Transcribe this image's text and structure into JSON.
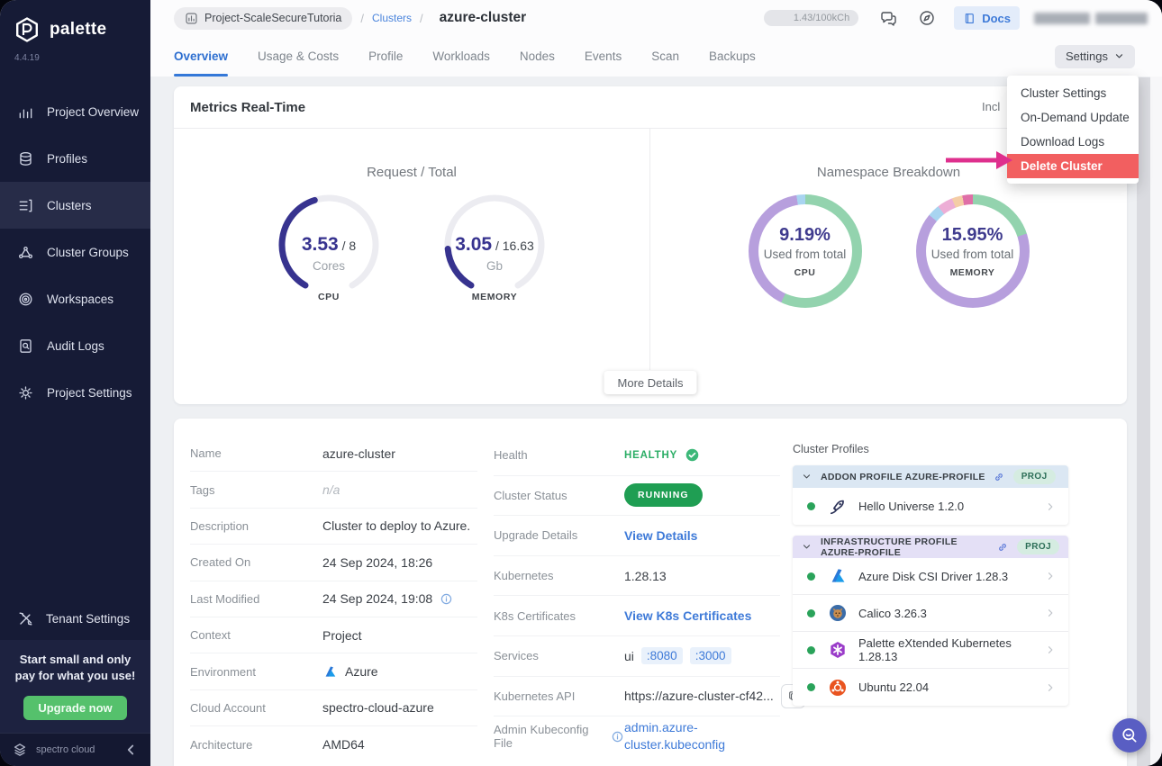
{
  "app": {
    "name": "palette",
    "version": "4.4.19"
  },
  "sidebar": {
    "items": [
      {
        "label": "Project Overview",
        "icon": "overview",
        "active": false
      },
      {
        "label": "Profiles",
        "icon": "profiles",
        "active": false
      },
      {
        "label": "Clusters",
        "icon": "clusters",
        "active": true
      },
      {
        "label": "Cluster Groups",
        "icon": "cluster-groups",
        "active": false
      },
      {
        "label": "Workspaces",
        "icon": "workspaces",
        "active": false
      },
      {
        "label": "Audit Logs",
        "icon": "audit",
        "active": false
      },
      {
        "label": "Project Settings",
        "icon": "gear",
        "active": false
      }
    ],
    "tenant_settings_label": "Tenant Settings",
    "upgrade": {
      "message": "Start small and only pay for what you use!",
      "button_label": "Upgrade now"
    },
    "footer_brand": "spectro cloud"
  },
  "header": {
    "breadcrumb": {
      "project": "Project-ScaleSecureTutoria",
      "section": "Clusters",
      "current": "azure-cluster"
    },
    "usage_badge": "1.43/100kCh",
    "docs_label": "Docs"
  },
  "tabs": {
    "items": [
      "Overview",
      "Usage & Costs",
      "Profile",
      "Workloads",
      "Nodes",
      "Events",
      "Scan",
      "Backups"
    ],
    "active": "Overview",
    "settings_button_label": "Settings"
  },
  "settings_menu": {
    "items": [
      "Cluster Settings",
      "On-Demand Update",
      "Download Logs",
      "Delete Cluster"
    ],
    "highlighted": "Delete Cluster"
  },
  "metrics": {
    "title": "Metrics Real-Time",
    "clipped_right_text": "Incl",
    "left_title": "Request / Total",
    "right_title": "Namespace Breakdown",
    "more_details_label": "More Details"
  },
  "chart_data": [
    {
      "type": "gauge",
      "group": "Request / Total",
      "label": "CPU",
      "value": "3.53",
      "total": "8",
      "unit": "Cores",
      "color": "#37338f",
      "track": "#ececf1"
    },
    {
      "type": "gauge",
      "group": "Request / Total",
      "label": "MEMORY",
      "value": "3.05",
      "total": "16.63",
      "unit": "Gb",
      "color": "#37338f",
      "track": "#ececf1"
    },
    {
      "type": "donut",
      "group": "Namespace Breakdown",
      "label": "CPU",
      "center_value": "9.19%",
      "center_caption": "Used from total",
      "segments": [
        {
          "color": "#93d3ae",
          "pct": 57
        },
        {
          "color": "#b79fdd",
          "pct": 40.5
        },
        {
          "color": "#a8d4f0",
          "pct": 2.5
        }
      ]
    },
    {
      "type": "donut",
      "group": "Namespace Breakdown",
      "label": "MEMORY",
      "center_value": "15.95%",
      "center_caption": "Used from total",
      "segments": [
        {
          "color": "#93d3ae",
          "pct": 20
        },
        {
          "color": "#b79fdd",
          "pct": 66
        },
        {
          "color": "#a8d4f0",
          "pct": 3.5
        },
        {
          "color": "#edaed6",
          "pct": 4.5
        },
        {
          "color": "#f4cda6",
          "pct": 3
        },
        {
          "color": "#df6fa7",
          "pct": 3
        }
      ]
    }
  ],
  "cluster_info": {
    "rows": [
      {
        "label": "Name",
        "value": "azure-cluster"
      },
      {
        "label": "Tags",
        "value": "n/a",
        "muted": true
      },
      {
        "label": "Description",
        "value": "Cluster to deploy to Azure."
      },
      {
        "label": "Created On",
        "value": "24 Sep 2024, 18:26"
      },
      {
        "label": "Last Modified",
        "value": "24 Sep 2024, 19:08",
        "info": true
      },
      {
        "label": "Context",
        "value": "Project"
      },
      {
        "label": "Environment",
        "value": "Azure",
        "icon": "azure"
      },
      {
        "label": "Cloud Account",
        "value": "spectro-cloud-azure"
      },
      {
        "label": "Architecture",
        "value": "AMD64"
      }
    ]
  },
  "cluster_status": {
    "rows": [
      {
        "label": "Health",
        "kind": "health",
        "value": "HEALTHY"
      },
      {
        "label": "Cluster Status",
        "kind": "badge",
        "value": "RUNNING"
      },
      {
        "label": "Upgrade Details",
        "kind": "link",
        "value": "View Details"
      },
      {
        "label": "Kubernetes",
        "kind": "text",
        "value": "1.28.13"
      },
      {
        "label": "K8s Certificates",
        "kind": "link",
        "value": "View K8s Certificates"
      },
      {
        "label": "Services",
        "kind": "services",
        "value": "ui",
        "ports": [
          ":8080",
          ":3000"
        ]
      },
      {
        "label": "Kubernetes API",
        "kind": "api",
        "value": "https://azure-cluster-cf42..."
      },
      {
        "label": "Admin Kubeconfig File",
        "kind": "filelink",
        "info": true,
        "value": "admin.azure-cluster.kubeconfig"
      }
    ]
  },
  "cluster_profiles": {
    "title": "Cluster Profiles",
    "groups": [
      {
        "header": "ADDON PROFILE AZURE-PROFILE",
        "badge": "PROJ",
        "theme": "blue",
        "items": [
          {
            "name": "Hello Universe 1.2.0",
            "icon": "rocket"
          }
        ]
      },
      {
        "header": "INFRASTRUCTURE PROFILE AZURE-PROFILE",
        "badge": "PROJ",
        "theme": "purple",
        "items": [
          {
            "name": "Azure Disk CSI Driver 1.28.3",
            "icon": "azure"
          },
          {
            "name": "Calico 3.26.3",
            "icon": "calico"
          },
          {
            "name": "Palette eXtended Kubernetes 1.28.13",
            "icon": "pxk"
          },
          {
            "name": "Ubuntu 22.04",
            "icon": "ubuntu"
          }
        ]
      }
    ]
  }
}
